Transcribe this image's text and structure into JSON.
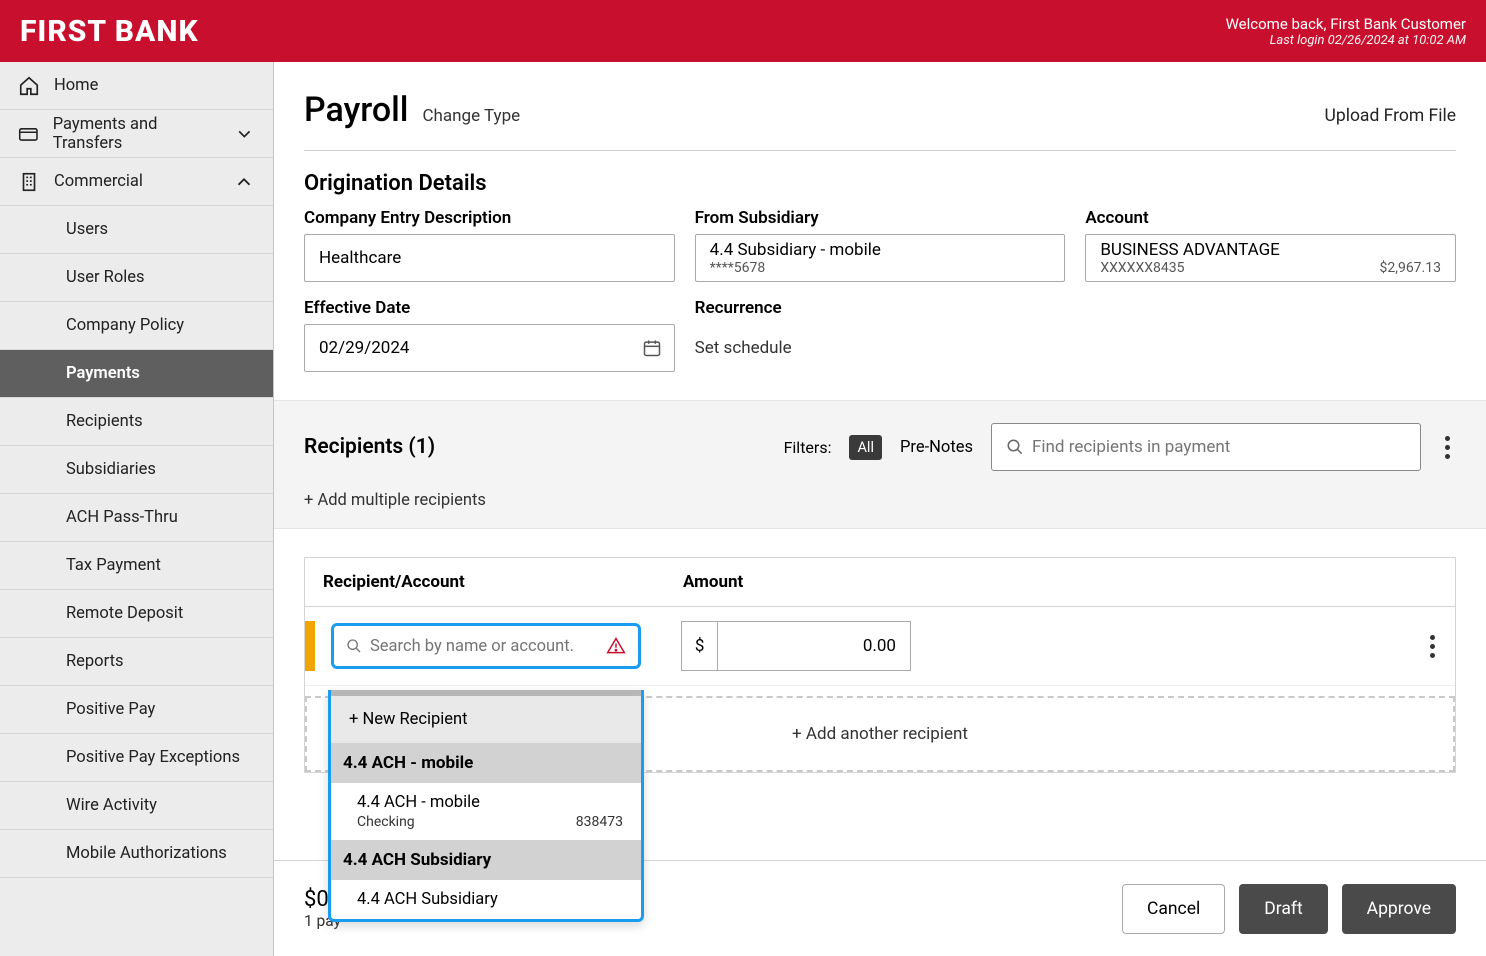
{
  "header": {
    "logo": "FIRST BANK",
    "welcome": "Welcome back, First Bank Customer",
    "last_login": "Last login 02/26/2024 at 10:02 AM"
  },
  "sidebar": {
    "home": "Home",
    "payments_transfers": "Payments and Transfers",
    "commercial": "Commercial",
    "items": [
      "Users",
      "User Roles",
      "Company Policy",
      "Payments",
      "Recipients",
      "Subsidiaries",
      "ACH Pass-Thru",
      "Tax Payment",
      "Remote Deposit",
      "Reports",
      "Positive Pay",
      "Positive Pay Exceptions",
      "Wire Activity",
      "Mobile Authorizations"
    ]
  },
  "page": {
    "title": "Payroll",
    "change_type": "Change Type",
    "upload": "Upload From File"
  },
  "origination": {
    "section": "Origination Details",
    "desc_label": "Company Entry Description",
    "desc_value": "Healthcare",
    "subsidiary_label": "From Subsidiary",
    "subsidiary_value": "4.4 Subsidiary - mobile",
    "subsidiary_mask": "****5678",
    "account_label": "Account",
    "account_value": "BUSINESS ADVANTAGE",
    "account_mask": "XXXXXX8435",
    "account_balance": "$2,967.13",
    "date_label": "Effective Date",
    "date_value": "02/29/2024",
    "recurrence_label": "Recurrence",
    "recurrence_link": "Set schedule"
  },
  "recipients": {
    "heading": "Recipients (1)",
    "filters_label": "Filters:",
    "all_pill": "All",
    "prenotes": "Pre-Notes",
    "search_placeholder": "Find recipients in payment",
    "add_multiple": "+ Add multiple recipients",
    "col_recipient": "Recipient/Account",
    "col_amount": "Amount",
    "row_search_placeholder": "Search by name or account.",
    "currency": "$",
    "amount_value": "0.00",
    "add_another": "+ Add another recipient"
  },
  "dropdown": {
    "new_recipient": "+ New Recipient",
    "group1_header": "4.4 ACH - mobile",
    "group1_item_name": "4.4 ACH - mobile",
    "group1_item_type": "Checking",
    "group1_item_num": "838473",
    "group2_header": "4.4 ACH Subsidiary",
    "group2_item_name": "4.4 ACH Subsidiary"
  },
  "footer": {
    "total": "$0.0",
    "count": "1 pay",
    "cancel": "Cancel",
    "draft": "Draft",
    "approve": "Approve"
  }
}
